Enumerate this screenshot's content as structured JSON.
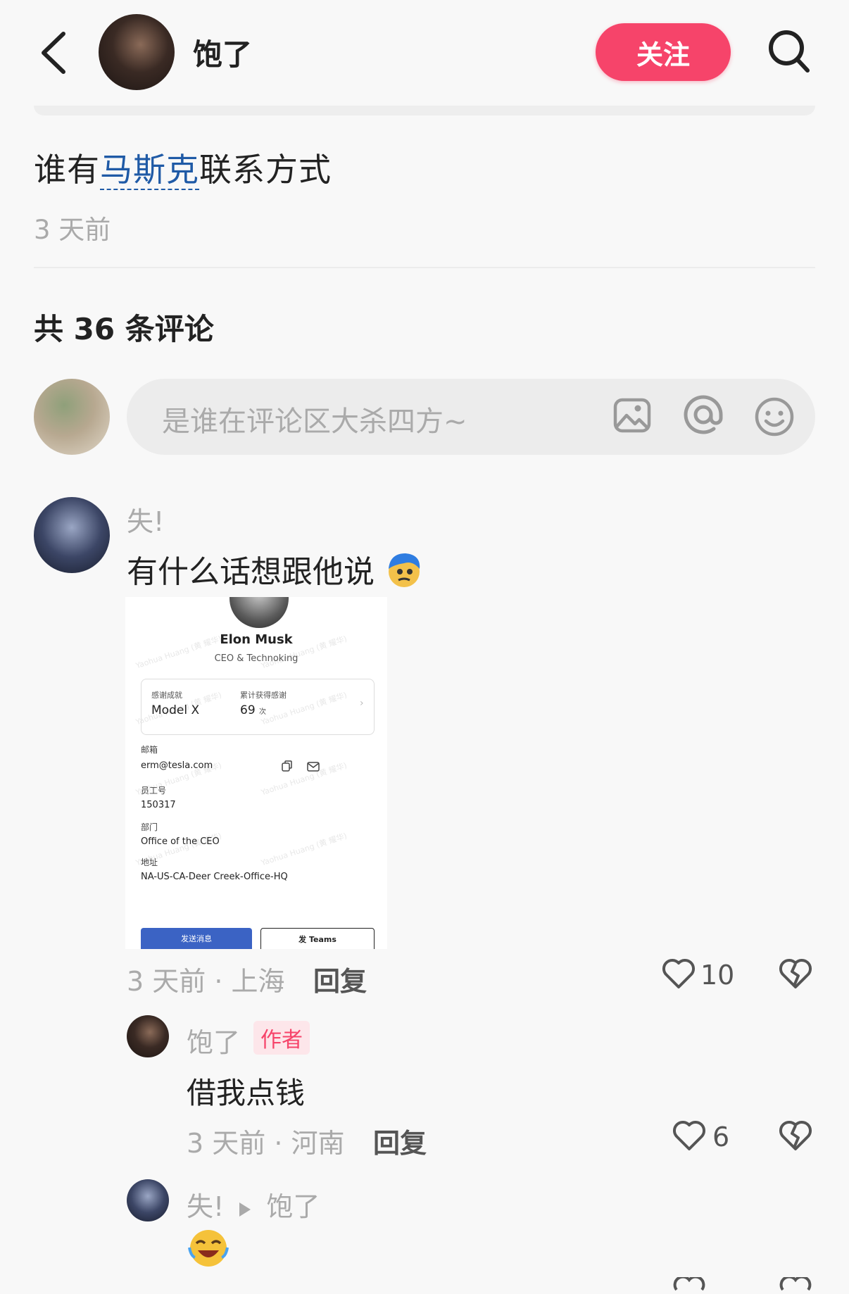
{
  "header": {
    "author_name": "饱了",
    "follow_label": "关注"
  },
  "post": {
    "title_before": "谁有",
    "title_link": "马斯克",
    "title_after": "联系方式",
    "time": "3 天前"
  },
  "comments_section": {
    "count_label": "共 36 条评论",
    "input_placeholder": "是谁在评论区大杀四方~"
  },
  "comments": [
    {
      "user": "失!",
      "text": "有什么话想跟他说",
      "meta": "3 天前 · 上海",
      "reply_label": "回复",
      "likes": "10",
      "image_card": {
        "name": "Elon Musk",
        "title": "CEO & Technoking",
        "achievement_label": "感谢成就",
        "achievement_value": "Model X",
        "thanks_label": "累计获得感谢",
        "thanks_value": "69",
        "thanks_unit": "次",
        "email_label": "邮箱",
        "email": "erm@tesla.com",
        "employee_id_label": "员工号",
        "employee_id": "150317",
        "department_label": "部门",
        "department": "Office of the CEO",
        "address_label": "地址",
        "address": "NA-US-CA-Deer Creek-Office-HQ",
        "send_message_label": "发送消息",
        "teams_label": "发 Teams"
      }
    },
    {
      "user": "饱了",
      "author_tag": "作者",
      "text": "借我点钱",
      "meta": "3 天前 · 河南",
      "reply_label": "回复",
      "likes": "6"
    },
    {
      "user": "失!",
      "reply_to": "饱了"
    }
  ],
  "colors": {
    "accent": "#f6446a",
    "link": "#1f5aa6"
  }
}
